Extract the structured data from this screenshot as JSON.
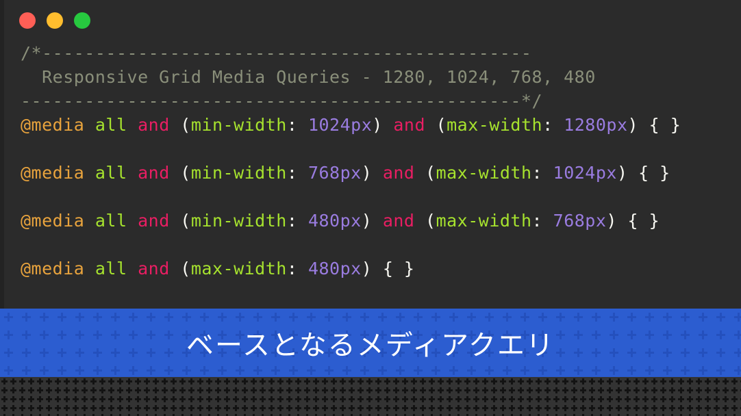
{
  "window": {
    "traffic_lights": [
      {
        "name": "close",
        "color": "#ff5f56"
      },
      {
        "name": "minimize",
        "color": "#ffbd2e"
      },
      {
        "name": "maximize",
        "color": "#27c93f"
      }
    ]
  },
  "code": {
    "language": "css",
    "background": "#2b2b2b",
    "comment_color": "#8a8f7a",
    "lines": [
      {
        "id": "comment-open",
        "tokens": [
          {
            "text": "/*----------------------------------------------",
            "type": "comment"
          }
        ]
      },
      {
        "id": "comment-title",
        "tokens": [
          {
            "text": "  Responsive Grid Media Queries - 1280, 1024, 768, 480",
            "type": "comment"
          }
        ]
      },
      {
        "id": "comment-close",
        "tokens": [
          {
            "text": "-----------------------------------------------*/",
            "type": "comment"
          }
        ]
      },
      {
        "id": "media-1280",
        "tokens": [
          {
            "text": "@media",
            "type": "at"
          },
          {
            "text": " ",
            "type": "punct"
          },
          {
            "text": "all",
            "type": "all"
          },
          {
            "text": " ",
            "type": "punct"
          },
          {
            "text": "and",
            "type": "and"
          },
          {
            "text": " (",
            "type": "punct"
          },
          {
            "text": "min-width",
            "type": "prop"
          },
          {
            "text": ": ",
            "type": "colon"
          },
          {
            "text": "1024px",
            "type": "value"
          },
          {
            "text": ") ",
            "type": "punct"
          },
          {
            "text": "and",
            "type": "and"
          },
          {
            "text": " (",
            "type": "punct"
          },
          {
            "text": "max-width",
            "type": "prop"
          },
          {
            "text": ": ",
            "type": "colon"
          },
          {
            "text": "1280px",
            "type": "value"
          },
          {
            "text": ") ",
            "type": "punct"
          },
          {
            "text": "{ }",
            "type": "brace"
          }
        ]
      },
      {
        "id": "blank-1",
        "tokens": []
      },
      {
        "id": "media-1024",
        "tokens": [
          {
            "text": "@media",
            "type": "at"
          },
          {
            "text": " ",
            "type": "punct"
          },
          {
            "text": "all",
            "type": "all"
          },
          {
            "text": " ",
            "type": "punct"
          },
          {
            "text": "and",
            "type": "and"
          },
          {
            "text": " (",
            "type": "punct"
          },
          {
            "text": "min-width",
            "type": "prop"
          },
          {
            "text": ": ",
            "type": "colon"
          },
          {
            "text": "768px",
            "type": "value"
          },
          {
            "text": ") ",
            "type": "punct"
          },
          {
            "text": "and",
            "type": "and"
          },
          {
            "text": " (",
            "type": "punct"
          },
          {
            "text": "max-width",
            "type": "prop"
          },
          {
            "text": ": ",
            "type": "colon"
          },
          {
            "text": "1024px",
            "type": "value"
          },
          {
            "text": ") ",
            "type": "punct"
          },
          {
            "text": "{ }",
            "type": "brace"
          }
        ]
      },
      {
        "id": "blank-2",
        "tokens": []
      },
      {
        "id": "media-768",
        "tokens": [
          {
            "text": "@media",
            "type": "at"
          },
          {
            "text": " ",
            "type": "punct"
          },
          {
            "text": "all",
            "type": "all"
          },
          {
            "text": " ",
            "type": "punct"
          },
          {
            "text": "and",
            "type": "and"
          },
          {
            "text": " (",
            "type": "punct"
          },
          {
            "text": "min-width",
            "type": "prop"
          },
          {
            "text": ": ",
            "type": "colon"
          },
          {
            "text": "480px",
            "type": "value"
          },
          {
            "text": ") ",
            "type": "punct"
          },
          {
            "text": "and",
            "type": "and"
          },
          {
            "text": " (",
            "type": "punct"
          },
          {
            "text": "max-width",
            "type": "prop"
          },
          {
            "text": ": ",
            "type": "colon"
          },
          {
            "text": "768px",
            "type": "value"
          },
          {
            "text": ") ",
            "type": "punct"
          },
          {
            "text": "{ }",
            "type": "brace"
          }
        ]
      },
      {
        "id": "blank-3",
        "tokens": []
      },
      {
        "id": "media-480",
        "tokens": [
          {
            "text": "@media",
            "type": "at"
          },
          {
            "text": " ",
            "type": "punct"
          },
          {
            "text": "all",
            "type": "all"
          },
          {
            "text": " ",
            "type": "punct"
          },
          {
            "text": "and",
            "type": "and"
          },
          {
            "text": " (",
            "type": "punct"
          },
          {
            "text": "max-width",
            "type": "prop"
          },
          {
            "text": ": ",
            "type": "colon"
          },
          {
            "text": "480px",
            "type": "value"
          },
          {
            "text": ") ",
            "type": "punct"
          },
          {
            "text": "{ }",
            "type": "brace"
          }
        ]
      }
    ]
  },
  "caption": {
    "text": "ベースとなるメディアクエリ",
    "background": "#2c5dd0",
    "color": "#ffffff"
  },
  "footer": {
    "background": "#333333",
    "pattern": "plus-grid"
  }
}
